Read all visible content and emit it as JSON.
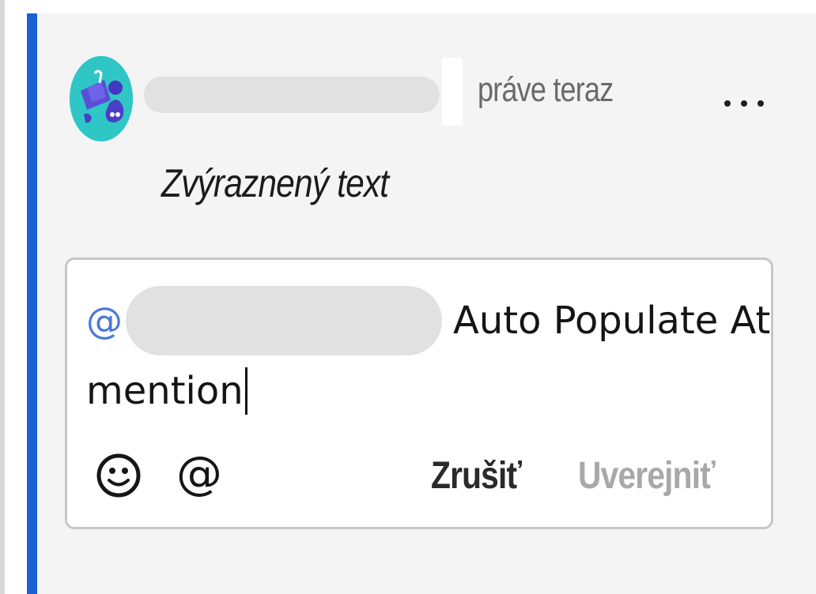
{
  "comment": {
    "author": "",
    "timestamp": "práve teraz",
    "more_icon": "more-horizontal-icon",
    "body": "Zvýraznený text",
    "avatar_icon": "avatar-illustration-icon"
  },
  "reply": {
    "at_symbol": "@",
    "mentioned_user": "",
    "text_line1": "Auto Populate At",
    "text_line2": "mention",
    "emoji_icon": "smiley-icon",
    "mention_label": "@",
    "cancel_label": "Zrušiť",
    "post_label": "Uverejniť"
  },
  "colors": {
    "accent": "#1a5fd4",
    "avatar_bg": "#2fc6c6",
    "mention": "#4a78d8",
    "disabled": "#a8a8a8"
  }
}
